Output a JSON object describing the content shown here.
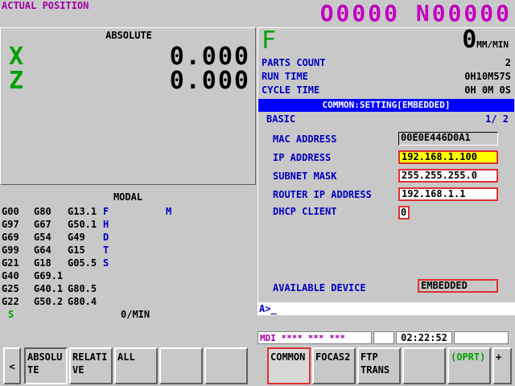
{
  "header": {
    "title": "ACTUAL POSITION",
    "program": "O0000 N00000"
  },
  "absolute": {
    "label": "ABSOLUTE",
    "axes": [
      {
        "name": "X",
        "value": "0.000"
      },
      {
        "name": "Z",
        "value": "0.000"
      }
    ]
  },
  "modal": {
    "label": "MODAL",
    "rows": [
      [
        "G00",
        "G80",
        "G13.1",
        "F",
        "M"
      ],
      [
        "G97",
        "G67",
        "G50.1",
        "H",
        ""
      ],
      [
        "G69",
        "G54",
        "G49",
        "D",
        ""
      ],
      [
        "G99",
        "G64",
        "G15",
        "T",
        ""
      ],
      [
        "G21",
        "G18",
        "G05.5",
        "S",
        ""
      ],
      [
        "G40",
        "G69.1",
        "",
        "",
        ""
      ],
      [
        "G25",
        "G40.1",
        "G80.5",
        "",
        ""
      ],
      [
        "G22",
        "G50.2",
        "G80.4",
        "",
        ""
      ]
    ],
    "spindle_label": "S",
    "spindle_value": "0/MIN"
  },
  "feed": {
    "letter": "F",
    "value": "0",
    "unit": "MM/MIN"
  },
  "stats": {
    "parts_count_label": "PARTS COUNT",
    "parts_count_value": "2",
    "run_time_label": "RUN TIME",
    "run_time_value": "0H10M57S",
    "cycle_time_label": "CYCLE TIME",
    "cycle_time_value": "0H 0M 0S"
  },
  "settings": {
    "header": "COMMON:SETTING[EMBEDDED]",
    "section": "BASIC",
    "page": "1/ 2",
    "mac_label": "MAC ADDRESS",
    "mac_value": "00E0E446D0A1",
    "ip_label": "IP ADDRESS",
    "ip_value": "192.168.1.100",
    "subnet_label": "SUBNET MASK",
    "subnet_value": "255.255.255.0",
    "router_label": "ROUTER IP ADDRESS",
    "router_value": "192.168.1.1",
    "dhcp_label": "DHCP CLIENT",
    "dhcp_value": "0",
    "device_label": "AVAILABLE DEVICE",
    "device_value": "EMBEDDED"
  },
  "input_line": "A>_",
  "status": {
    "mode": "MDI  **** *** ***",
    "time": "02:22:52"
  },
  "softkeys": {
    "left_arrow": "<",
    "absolute_line1": "ABSOLU",
    "absolute_line2": "TE",
    "relative_line1": "RELATI",
    "relative_line2": "VE",
    "all": "ALL",
    "common": "COMMON",
    "focas2": "FOCAS2",
    "ftp_line1": "FTP",
    "ftp_line2": "TRANS",
    "oprt": "(OPRT)",
    "plus": "+"
  },
  "colors": {
    "axis_green": "#00a000",
    "header_blue": "#0000ff",
    "label_blue": "#0000c0",
    "title_magenta": "#c000c0",
    "highlight_yellow": "#ffff00",
    "border_red": "#e03030"
  }
}
